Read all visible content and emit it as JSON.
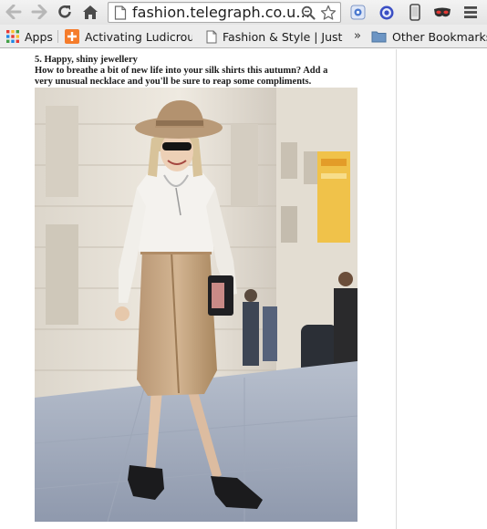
{
  "browser": {
    "url": "fashion.telegraph.co.uk...",
    "icons": {
      "back": "arrow-left-icon",
      "forward": "arrow-right-icon",
      "reload": "reload-icon",
      "home": "home-icon",
      "page": "document-icon",
      "zoom": "zoom-icon",
      "bookmark_star": "star-icon",
      "extension_1": "translate-extension-icon",
      "extension_2": "target-extension-icon",
      "device": "phone-icon",
      "extension_3": "mask-extension-icon",
      "menu": "hamburger-menu-icon"
    }
  },
  "bookmarks": {
    "apps_label": "Apps",
    "items": [
      {
        "label": "Activating Ludicrous",
        "icon": "orange-bookmark-icon"
      },
      {
        "label": "Fashion & Style | Just",
        "icon": "document-icon"
      }
    ],
    "overflow_label": "»",
    "other_label": "Other Bookmarks"
  },
  "article": {
    "heading": "5. Happy, shiny jewellery",
    "caption_line1": "How to breathe a bit of new life into your silk shirts this autumn? Add a",
    "caption_line2": "very unusual necklace and you'll be sure to reap some compliments."
  },
  "photo": {
    "subject": "street-style-photo",
    "colors": {
      "sky": "#dfe6ef",
      "building": "#ece6da",
      "pavement": "#aab3c4",
      "skirt": "#c9a987",
      "shirt": "#f4f2ee",
      "hat": "#b99a78",
      "sign": "#f0c24a"
    }
  }
}
